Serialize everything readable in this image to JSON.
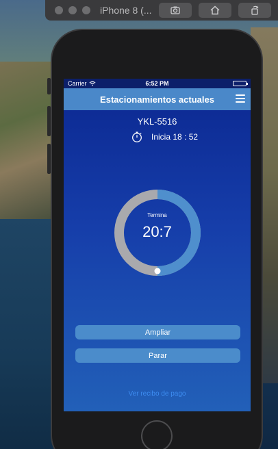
{
  "simulator": {
    "title": "iPhone 8 (..."
  },
  "status_bar": {
    "carrier": "Carrier",
    "time": "6:52 PM",
    "battery_level": 1.0
  },
  "navbar": {
    "title": "Estacionamientos actuales"
  },
  "parking": {
    "plate": "YKL-5516",
    "start_label": "Inicia 18 : 52",
    "timer_caption": "Termina",
    "timer_value": "20:7",
    "progress": 0.5
  },
  "actions": {
    "extend_label": "Ampliar",
    "stop_label": "Parar",
    "receipt_link": "Ver recibo de pago"
  },
  "colors": {
    "navbar": "#4a88c9",
    "button": "#4b8ccb",
    "link": "#3d8cf0",
    "ring_track": "#a9a9ad",
    "ring_progress": "#4f8fcd"
  }
}
